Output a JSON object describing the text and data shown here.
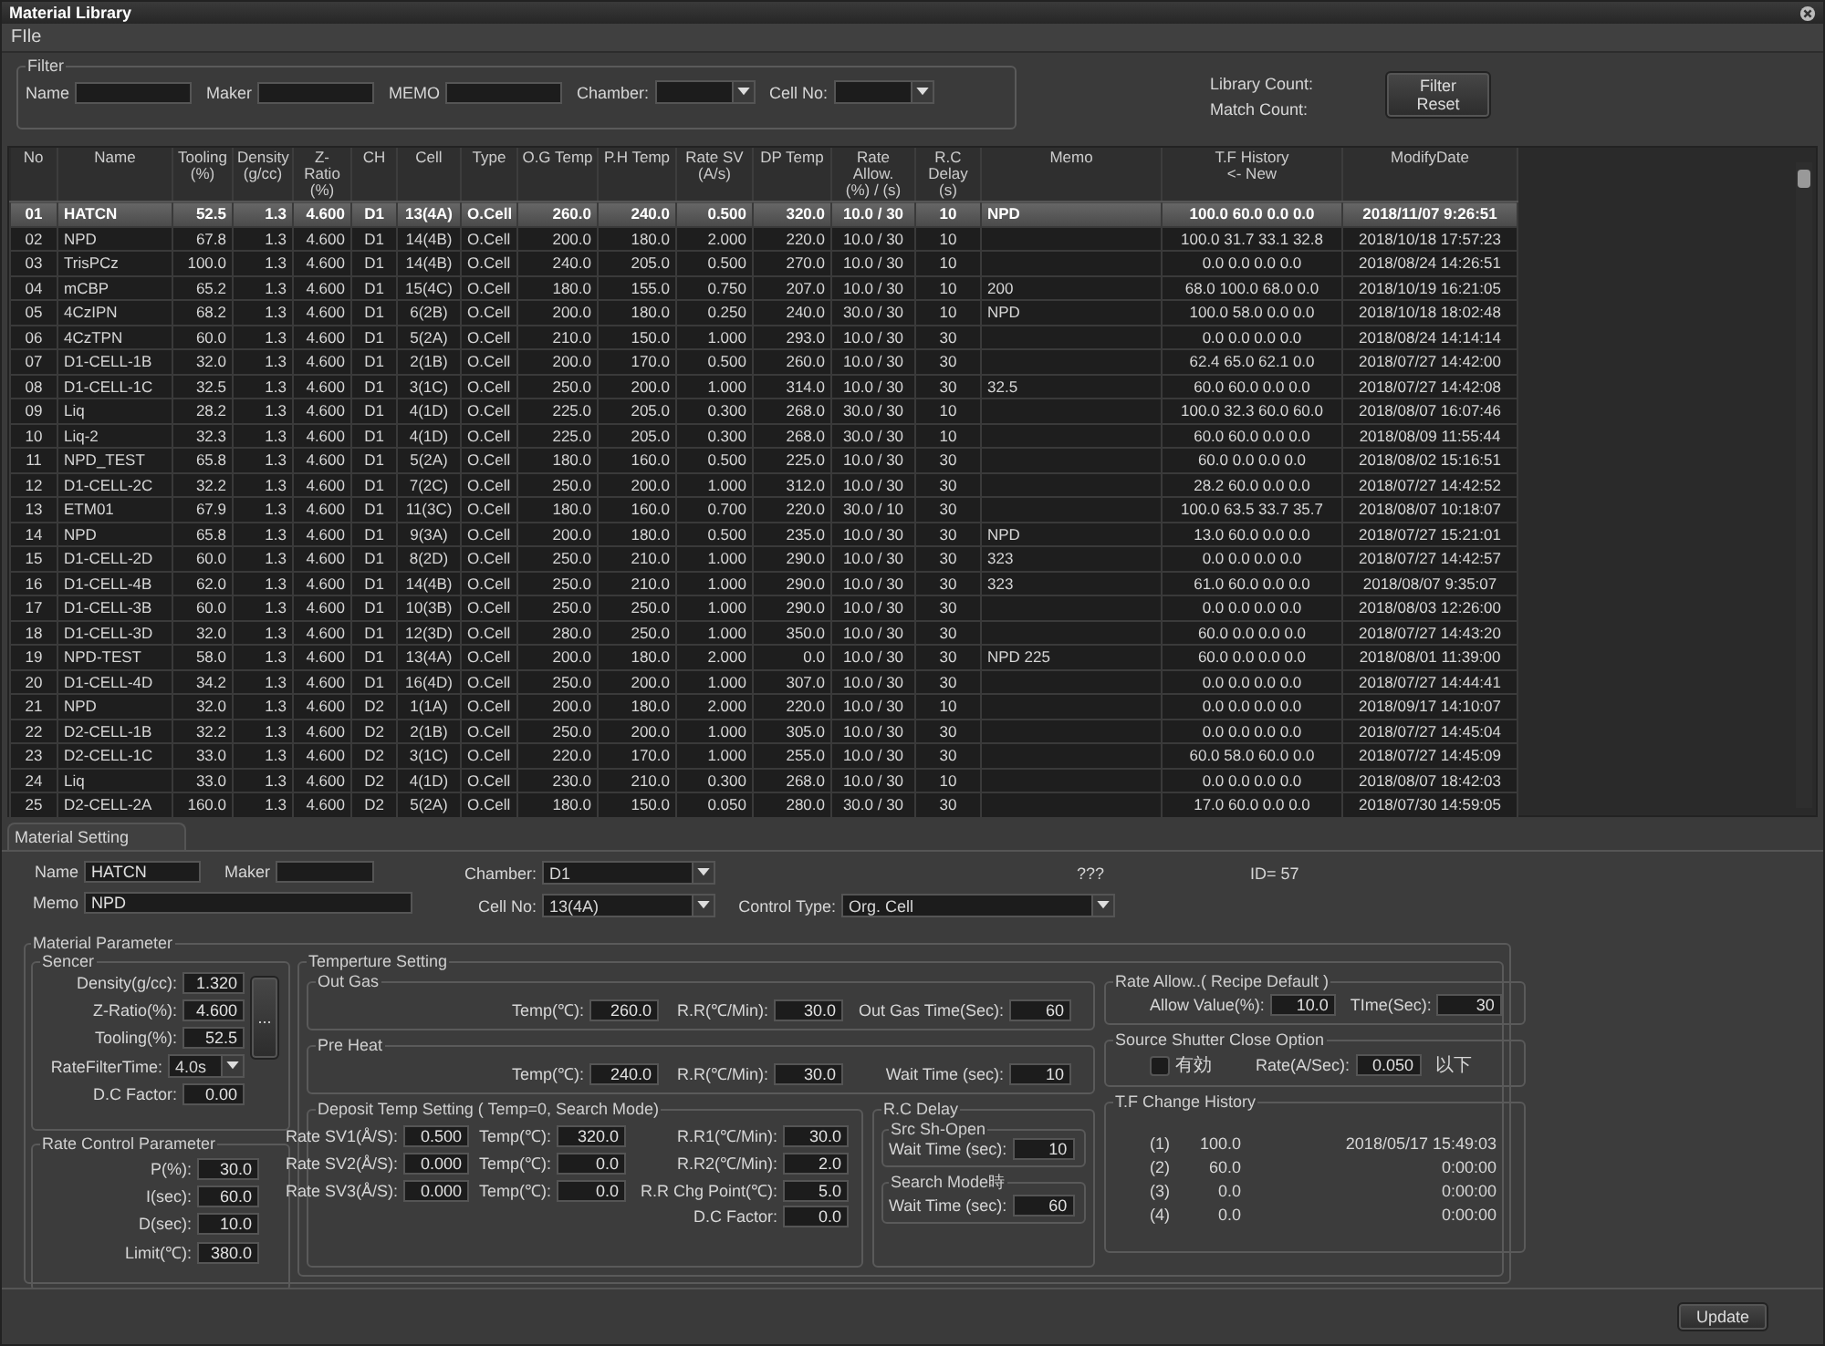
{
  "window": {
    "title": "Material Library"
  },
  "menu": [
    "FIle"
  ],
  "filter": {
    "title": "Filter",
    "fields": [
      {
        "label": "Name",
        "kind": "text"
      },
      {
        "label": "Maker",
        "kind": "text"
      },
      {
        "label": "MEMO",
        "kind": "text"
      },
      {
        "label": "Chamber:",
        "kind": "combo"
      },
      {
        "label": "Cell No:",
        "kind": "combo"
      }
    ],
    "library_count_label": "Library Count:",
    "match_count_label": "Match Count:",
    "reset_button": "Filter Reset"
  },
  "table": {
    "columns": [
      "No",
      "Name",
      "Tooling\n(%)",
      "Density\n(g/cc)",
      "Z-Ratio\n(%)",
      "CH",
      "Cell",
      "Type",
      "O.G Temp",
      "P.H Temp",
      "Rate SV\n(A/s)",
      "DP Temp",
      "Rate Allow.\n(%) / (s)",
      "R.C Delay\n(s)",
      "Memo",
      "T.F History\n<- New",
      "ModifyDate"
    ],
    "rows": [
      {
        "selected": true,
        "cells": [
          "01",
          "HATCN",
          "52.5",
          "1.3",
          "4.600",
          "D1",
          "13(4A)",
          "O.Cell",
          "260.0",
          "240.0",
          "0.500",
          "320.0",
          "10.0 / 30",
          "10",
          "NPD",
          "100.0 60.0 0.0 0.0",
          "2018/11/07 9:26:51"
        ]
      },
      {
        "selected": false,
        "cells": [
          "02",
          "NPD",
          "67.8",
          "1.3",
          "4.600",
          "D1",
          "14(4B)",
          "O.Cell",
          "200.0",
          "180.0",
          "2.000",
          "220.0",
          "10.0 / 30",
          "10",
          "",
          "100.0 31.7 33.1 32.8",
          "2018/10/18 17:57:23"
        ]
      },
      {
        "selected": false,
        "cells": [
          "03",
          "TrisPCz",
          "100.0",
          "1.3",
          "4.600",
          "D1",
          "14(4B)",
          "O.Cell",
          "240.0",
          "205.0",
          "0.500",
          "270.0",
          "10.0 / 30",
          "10",
          "",
          "0.0 0.0 0.0 0.0",
          "2018/08/24 14:26:51"
        ]
      },
      {
        "selected": false,
        "cells": [
          "04",
          "mCBP",
          "65.2",
          "1.3",
          "4.600",
          "D1",
          "15(4C)",
          "O.Cell",
          "180.0",
          "155.0",
          "0.750",
          "207.0",
          "10.0 / 30",
          "10",
          "200",
          "68.0 100.0 68.0 0.0",
          "2018/10/19 16:21:05"
        ]
      },
      {
        "selected": false,
        "cells": [
          "05",
          "4CzIPN",
          "68.2",
          "1.3",
          "4.600",
          "D1",
          "6(2B)",
          "O.Cell",
          "200.0",
          "180.0",
          "0.250",
          "240.0",
          "30.0 / 30",
          "10",
          "NPD",
          "100.0 58.0 0.0 0.0",
          "2018/10/18 18:02:48"
        ]
      },
      {
        "selected": false,
        "cells": [
          "06",
          "4CzTPN",
          "60.0",
          "1.3",
          "4.600",
          "D1",
          "5(2A)",
          "O.Cell",
          "210.0",
          "150.0",
          "1.000",
          "293.0",
          "10.0 / 30",
          "30",
          "",
          "0.0 0.0 0.0 0.0",
          "2018/08/24 14:14:14"
        ]
      },
      {
        "selected": false,
        "cells": [
          "07",
          "D1-CELL-1B",
          "32.0",
          "1.3",
          "4.600",
          "D1",
          "2(1B)",
          "O.Cell",
          "200.0",
          "170.0",
          "0.500",
          "260.0",
          "10.0 / 30",
          "30",
          "",
          "62.4 65.0 62.1 0.0",
          "2018/07/27 14:42:00"
        ]
      },
      {
        "selected": false,
        "cells": [
          "08",
          "D1-CELL-1C",
          "32.5",
          "1.3",
          "4.600",
          "D1",
          "3(1C)",
          "O.Cell",
          "250.0",
          "200.0",
          "1.000",
          "314.0",
          "10.0 / 30",
          "30",
          "32.5",
          "60.0 60.0 0.0 0.0",
          "2018/07/27 14:42:08"
        ]
      },
      {
        "selected": false,
        "cells": [
          "09",
          "Liq",
          "28.2",
          "1.3",
          "4.600",
          "D1",
          "4(1D)",
          "O.Cell",
          "225.0",
          "205.0",
          "0.300",
          "268.0",
          "30.0 / 30",
          "10",
          "",
          "100.0 32.3 60.0 60.0",
          "2018/08/07 16:07:46"
        ]
      },
      {
        "selected": false,
        "cells": [
          "10",
          "Liq-2",
          "32.3",
          "1.3",
          "4.600",
          "D1",
          "4(1D)",
          "O.Cell",
          "225.0",
          "205.0",
          "0.300",
          "268.0",
          "30.0 / 30",
          "10",
          "",
          "60.0 60.0 0.0 0.0",
          "2018/08/09 11:55:44"
        ]
      },
      {
        "selected": false,
        "cells": [
          "11",
          "NPD_TEST",
          "65.8",
          "1.3",
          "4.600",
          "D1",
          "5(2A)",
          "O.Cell",
          "180.0",
          "160.0",
          "0.500",
          "225.0",
          "10.0 / 30",
          "30",
          "",
          "60.0 0.0 0.0 0.0",
          "2018/08/02 15:16:51"
        ]
      },
      {
        "selected": false,
        "cells": [
          "12",
          "D1-CELL-2C",
          "32.2",
          "1.3",
          "4.600",
          "D1",
          "7(2C)",
          "O.Cell",
          "250.0",
          "200.0",
          "1.000",
          "312.0",
          "10.0 / 30",
          "30",
          "",
          "28.2 60.0 0.0 0.0",
          "2018/07/27 14:42:52"
        ]
      },
      {
        "selected": false,
        "cells": [
          "13",
          "ETM01",
          "67.9",
          "1.3",
          "4.600",
          "D1",
          "11(3C)",
          "O.Cell",
          "180.0",
          "160.0",
          "0.700",
          "220.0",
          "30.0 / 10",
          "30",
          "",
          "100.0 63.5 33.7 35.7",
          "2018/08/07 10:18:07"
        ]
      },
      {
        "selected": false,
        "cells": [
          "14",
          "NPD",
          "65.8",
          "1.3",
          "4.600",
          "D1",
          "9(3A)",
          "O.Cell",
          "200.0",
          "180.0",
          "0.500",
          "235.0",
          "10.0 / 30",
          "30",
          "NPD",
          "13.0 60.0 0.0 0.0",
          "2018/07/27 15:21:01"
        ]
      },
      {
        "selected": false,
        "cells": [
          "15",
          "D1-CELL-2D",
          "60.0",
          "1.3",
          "4.600",
          "D1",
          "8(2D)",
          "O.Cell",
          "250.0",
          "210.0",
          "1.000",
          "290.0",
          "10.0 / 30",
          "30",
          "323",
          "0.0 0.0 0.0 0.0",
          "2018/07/27 14:42:57"
        ]
      },
      {
        "selected": false,
        "cells": [
          "16",
          "D1-CELL-4B",
          "62.0",
          "1.3",
          "4.600",
          "D1",
          "14(4B)",
          "O.Cell",
          "250.0",
          "210.0",
          "1.000",
          "290.0",
          "10.0 / 30",
          "30",
          "323",
          "61.0 60.0 0.0 0.0",
          "2018/08/07 9:35:07"
        ]
      },
      {
        "selected": false,
        "cells": [
          "17",
          "D1-CELL-3B",
          "60.0",
          "1.3",
          "4.600",
          "D1",
          "10(3B)",
          "O.Cell",
          "250.0",
          "250.0",
          "1.000",
          "290.0",
          "10.0 / 30",
          "30",
          "",
          "0.0 0.0 0.0 0.0",
          "2018/08/03 12:26:00"
        ]
      },
      {
        "selected": false,
        "cells": [
          "18",
          "D1-CELL-3D",
          "32.0",
          "1.3",
          "4.600",
          "D1",
          "12(3D)",
          "O.Cell",
          "280.0",
          "250.0",
          "1.000",
          "350.0",
          "10.0 / 30",
          "30",
          "",
          "60.0 0.0 0.0 0.0",
          "2018/07/27 14:43:20"
        ]
      },
      {
        "selected": false,
        "cells": [
          "19",
          "NPD-TEST",
          "58.0",
          "1.3",
          "4.600",
          "D1",
          "13(4A)",
          "O.Cell",
          "200.0",
          "180.0",
          "2.000",
          "0.0",
          "10.0 / 30",
          "30",
          "NPD 225",
          "60.0 0.0 0.0 0.0",
          "2018/08/01 11:39:00"
        ]
      },
      {
        "selected": false,
        "cells": [
          "20",
          "D1-CELL-4D",
          "34.2",
          "1.3",
          "4.600",
          "D1",
          "16(4D)",
          "O.Cell",
          "250.0",
          "200.0",
          "1.000",
          "307.0",
          "10.0 / 30",
          "30",
          "",
          "0.0 0.0 0.0 0.0",
          "2018/07/27 14:44:41"
        ]
      },
      {
        "selected": false,
        "cells": [
          "21",
          "NPD",
          "32.0",
          "1.3",
          "4.600",
          "D2",
          "1(1A)",
          "O.Cell",
          "200.0",
          "180.0",
          "2.000",
          "220.0",
          "10.0 / 30",
          "10",
          "",
          "0.0 0.0 0.0 0.0",
          "2018/09/17 14:10:07"
        ]
      },
      {
        "selected": false,
        "cells": [
          "22",
          "D2-CELL-1B",
          "32.2",
          "1.3",
          "4.600",
          "D2",
          "2(1B)",
          "O.Cell",
          "250.0",
          "200.0",
          "1.000",
          "305.0",
          "10.0 / 30",
          "30",
          "",
          "0.0 0.0 0.0 0.0",
          "2018/07/27 14:45:04"
        ]
      },
      {
        "selected": false,
        "cells": [
          "23",
          "D2-CELL-1C",
          "33.0",
          "1.3",
          "4.600",
          "D2",
          "3(1C)",
          "O.Cell",
          "220.0",
          "170.0",
          "1.000",
          "255.0",
          "10.0 / 30",
          "30",
          "",
          "60.0 58.0 60.0 0.0",
          "2018/07/27 14:45:09"
        ]
      },
      {
        "selected": false,
        "cells": [
          "24",
          "Liq",
          "33.0",
          "1.3",
          "4.600",
          "D2",
          "4(1D)",
          "O.Cell",
          "230.0",
          "210.0",
          "0.300",
          "268.0",
          "10.0 / 30",
          "10",
          "",
          "0.0 0.0 0.0 0.0",
          "2018/08/07 18:42:03"
        ]
      },
      {
        "selected": false,
        "cells": [
          "25",
          "D2-CELL-2A",
          "160.0",
          "1.3",
          "4.600",
          "D2",
          "5(2A)",
          "O.Cell",
          "180.0",
          "150.0",
          "0.050",
          "280.0",
          "30.0 / 30",
          "30",
          "",
          "17.0 60.0 0.0 0.0",
          "2018/07/30 14:59:05"
        ]
      }
    ]
  },
  "setting": {
    "tab": "Material Setting",
    "name": {
      "label": "Name",
      "value": "HATCN",
      "kind": "input"
    },
    "maker": {
      "label": "Maker",
      "kind": "input"
    },
    "memo": {
      "label": "Memo",
      "value": "NPD",
      "kind": "input"
    },
    "chamber": {
      "label": "Chamber:",
      "value": "D1",
      "kind": "combo"
    },
    "cell_no": {
      "label": "Cell No:",
      "value": "13(4A)",
      "kind": "combo"
    },
    "control_type": {
      "label": "Control Type:",
      "value": "Org. Cell",
      "kind": "combo"
    },
    "status": "???",
    "id": "ID= 57",
    "material_parameter": {
      "title": "Material Parameter",
      "sencer": {
        "title": "Sencer",
        "more_button": "...",
        "fields": [
          {
            "label": "Density(g/cc):",
            "value": "1.320",
            "kind": "input"
          },
          {
            "label": "Z-Ratio(%):",
            "value": "4.600",
            "kind": "input"
          },
          {
            "label": "Tooling(%):",
            "value": "52.5",
            "kind": "input"
          },
          {
            "label": "RateFilterTime:",
            "value": "4.0s",
            "kind": "combo"
          },
          {
            "label": "D.C Factor:",
            "value": "0.00",
            "kind": "input"
          }
        ]
      },
      "rate_control": {
        "title": "Rate Control Parameter",
        "fields": [
          {
            "label": "P(%):",
            "value": "30.0",
            "kind": "input"
          },
          {
            "label": "I(sec):",
            "value": "60.0",
            "kind": "input"
          },
          {
            "label": "D(sec):",
            "value": "10.0",
            "kind": "input"
          },
          {
            "label": "Limit(℃):",
            "value": "380.0",
            "kind": "input"
          }
        ]
      },
      "temperature": {
        "title": "Temperture Setting",
        "out_gas": {
          "title": "Out Gas",
          "fields": [
            {
              "label": "Temp(℃):",
              "value": "260.0",
              "kind": "input"
            },
            {
              "label": "R.R(℃/Min):",
              "value": "30.0",
              "kind": "input"
            },
            {
              "label": "Out Gas Time(Sec):",
              "value": "60",
              "kind": "input"
            }
          ]
        },
        "pre_heat": {
          "title": "Pre Heat",
          "fields": [
            {
              "label": "Temp(℃):",
              "value": "240.0",
              "kind": "input"
            },
            {
              "label": "R.R(℃/Min):",
              "value": "30.0",
              "kind": "input"
            },
            {
              "label": "Wait Time (sec):",
              "value": "10",
              "kind": "input"
            }
          ]
        },
        "deposit": {
          "title": "Deposit Temp Setting ( Temp=0, Search Mode)",
          "rows": [
            [
              {
                "label": "Rate SV1(Å/S):",
                "value": "0.500",
                "kind": "input"
              },
              {
                "label": "Temp(℃):",
                "value": "320.0",
                "kind": "input"
              },
              {
                "label": "R.R1(℃/Min):",
                "value": "30.0",
                "kind": "input"
              }
            ],
            [
              {
                "label": "Rate SV2(Å/S):",
                "value": "0.000",
                "kind": "input"
              },
              {
                "label": "Temp(℃):",
                "value": "0.0",
                "kind": "input"
              },
              {
                "label": "R.R2(℃/Min):",
                "value": "2.0",
                "kind": "input"
              }
            ],
            [
              {
                "label": "Rate SV3(Å/S):",
                "value": "0.000",
                "kind": "input"
              },
              {
                "label": "Temp(℃):",
                "value": "0.0",
                "kind": "input"
              },
              {
                "label": "R.R Chg Point(℃):",
                "value": "5.0",
                "kind": "input"
              }
            ]
          ],
          "dc_factor": {
            "label": "D.C Factor:",
            "value": "0.0",
            "kind": "input"
          }
        },
        "rc_delay": {
          "title": "R.C Delay",
          "groups": [
            {
              "title": "Src Sh-Open",
              "label": "Wait Time (sec):",
              "value": "10"
            },
            {
              "title": "Search Mode時",
              "label": "Wait Time (sec):",
              "value": "60"
            }
          ]
        },
        "rate_allow": {
          "title": "Rate Allow..( Recipe Default )",
          "fields": [
            {
              "label": "Allow Value(%):",
              "value": "10.0",
              "kind": "input"
            },
            {
              "label": "TIme(Sec):",
              "value": "30",
              "kind": "input"
            }
          ]
        },
        "shutter": {
          "title": "Source Shutter Close Option",
          "checkbox": {
            "label": "有効",
            "checked": false
          },
          "rate_label": "Rate(A/Sec):",
          "rate_value": "0.050",
          "unit": "以下"
        },
        "tf_history": {
          "title": "T.F Change History",
          "rows": [
            [
              "(1)",
              "100.0",
              "2018/05/17 15:49:03"
            ],
            [
              "(2)",
              "60.0",
              "0:00:00"
            ],
            [
              "(3)",
              "0.0",
              "0:00:00"
            ],
            [
              "(4)",
              "0.0",
              "0:00:00"
            ]
          ]
        }
      }
    }
  },
  "update_button": "Update"
}
